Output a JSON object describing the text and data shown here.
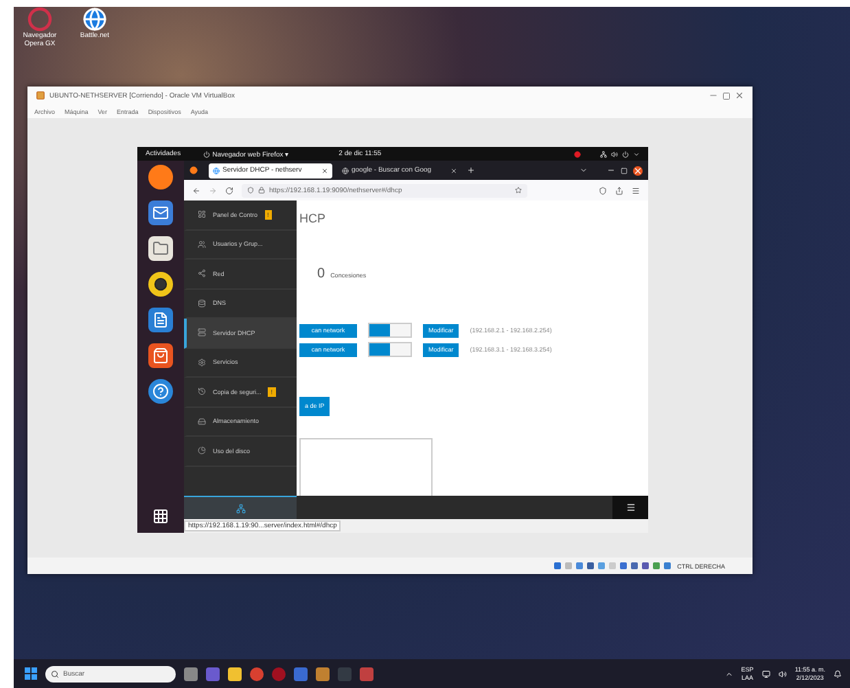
{
  "desktop_icons": [
    {
      "label": "Navegador Opera GX",
      "kind": "ring"
    },
    {
      "label": "Battle.net",
      "kind": "globe"
    }
  ],
  "vbox": {
    "title": "UBUNTO-NETHSERVER [Corriendo] - Oracle VM VirtualBox",
    "menu": [
      "Archivo",
      "Máquina",
      "Ver",
      "Entrada",
      "Dispositivos",
      "Ayuda"
    ],
    "host_key": "CTRL DERECHA"
  },
  "ubuntu": {
    "activities": "Actividades",
    "app": "Navegador web Firefox ▾",
    "clock": "2 de dic  11:55"
  },
  "browser": {
    "tabs": [
      {
        "label": "Servidor DHCP - nethserv",
        "selected": true
      },
      {
        "label": "google - Buscar con Goog",
        "selected": false
      }
    ],
    "url": "https://192.168.1.19:9090/nethserver#/dhcp",
    "status_url": "https://192.168.1.19:90...server/index.html#/dhcp"
  },
  "sidebar": {
    "items": [
      {
        "label": "Panel de Contro",
        "kind": "panel",
        "selected": false,
        "badge": "!"
      },
      {
        "label": "Usuarios y Grup...",
        "kind": "users",
        "selected": false
      },
      {
        "label": "Red",
        "kind": "network",
        "selected": false
      },
      {
        "label": "DNS",
        "kind": "dns",
        "selected": false
      },
      {
        "label": "Servidor DHCP",
        "kind": "dhcp",
        "selected": true
      },
      {
        "label": "Servicios",
        "kind": "services",
        "selected": false
      },
      {
        "label": "Copia de seguri...",
        "kind": "backup",
        "selected": false,
        "badge": "!"
      },
      {
        "label": "Almacenamiento",
        "kind": "storage",
        "selected": false
      },
      {
        "label": "Uso del disco",
        "kind": "disk",
        "selected": false
      }
    ]
  },
  "page": {
    "title": "HCP",
    "count": "0",
    "count_label": "Concesiones",
    "ranges": [
      {
        "button": "can network",
        "on": true,
        "action": "Modificar",
        "range": "(192.168.2.1 - 192.168.2.254)"
      },
      {
        "button": "can network",
        "on": true,
        "action": "Modificar",
        "range": "(192.168.3.1 - 192.168.3.254)"
      }
    ],
    "ip_button": "a de IP"
  },
  "taskbar": {
    "search": {
      "placeholder": "Buscar"
    },
    "lang": "ESP",
    "region": "LAA",
    "time": "11:55 a. m.",
    "date": "2/12/2023"
  }
}
